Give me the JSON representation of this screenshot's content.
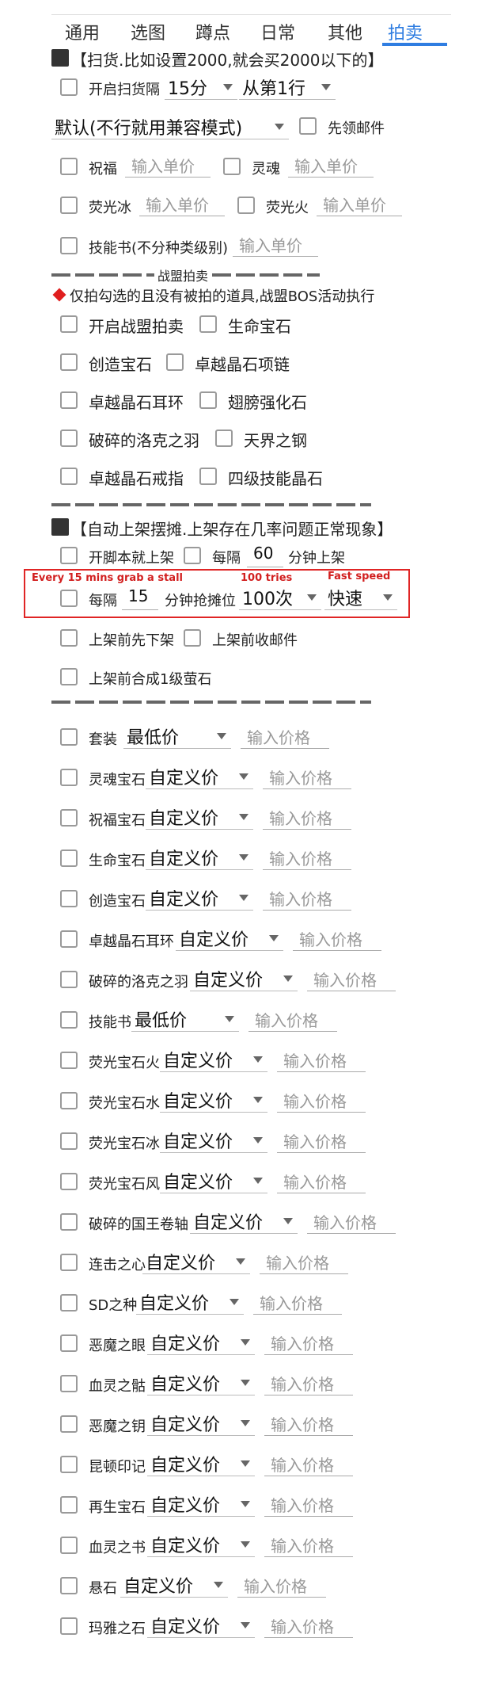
{
  "tabs": [
    "通用",
    "选图",
    "蹲点",
    "日常",
    "其他",
    "拍卖"
  ],
  "sweep": {
    "header": "【扫货.比如设置2000,就会买2000以下的】",
    "enable_label": "开启扫货隔",
    "interval_value": "15分",
    "row_value": "从第1行",
    "mode_value": "默认(不行就用兼容模式)",
    "mail_first_label": "先领邮件",
    "items": [
      {
        "label": "祝福",
        "placeholder": "输入单价"
      },
      {
        "label": "灵魂",
        "placeholder": "输入单价"
      },
      {
        "label": "荧光冰",
        "placeholder": "输入单价"
      },
      {
        "label": "荧光火",
        "placeholder": "输入单价"
      },
      {
        "label": "技能书(不分种类级别)",
        "placeholder": "输入单价"
      }
    ]
  },
  "alliance": {
    "divider_title": "战盟拍卖",
    "note": "仅拍勾选的且没有被拍的道具,战盟BOS活动执行",
    "items": [
      "开启战盟拍卖",
      "生命宝石",
      "创造宝石",
      "卓越晶石项链",
      "卓越晶石耳环",
      "翅膀强化石",
      "破碎的洛克之羽",
      "天界之钢",
      "卓越晶石戒指",
      "四级技能晶石"
    ]
  },
  "listing": {
    "header": "【自动上架摆摊.上架存在几率问题正常现象】",
    "open_label": "开脚本就上架",
    "every_label": "每隔",
    "every_value": "60",
    "every_unit": "分钟上架",
    "grab_every_label": "每隔",
    "grab_value": "15",
    "grab_unit": "分钟抢摊位",
    "tries_value": "100次",
    "speed_value": "快速",
    "annotations": {
      "grab": "Every 15 mins grab a stall",
      "tries": "100 tries",
      "speed": "Fast speed"
    },
    "before_unlist": "上架前先下架",
    "before_mail": "上架前收邮件",
    "before_merge": "上架前合成1级萤石"
  },
  "price_placeholder": "输入价格",
  "price_items": [
    {
      "label": "套装",
      "price_type": "最低价"
    },
    {
      "label": "灵魂宝石",
      "price_type": "自定义价"
    },
    {
      "label": "祝福宝石",
      "price_type": "自定义价"
    },
    {
      "label": "生命宝石",
      "price_type": "自定义价"
    },
    {
      "label": "创造宝石",
      "price_type": "自定义价"
    },
    {
      "label": "卓越晶石耳环",
      "price_type": "自定义价"
    },
    {
      "label": "破碎的洛克之羽",
      "price_type": "自定义价"
    },
    {
      "label": "技能书",
      "price_type": "最低价"
    },
    {
      "label": "荧光宝石火",
      "price_type": "自定义价"
    },
    {
      "label": "荧光宝石水",
      "price_type": "自定义价"
    },
    {
      "label": "荧光宝石冰",
      "price_type": "自定义价"
    },
    {
      "label": "荧光宝石风",
      "price_type": "自定义价"
    },
    {
      "label": "破碎的国王卷轴",
      "price_type": "自定义价"
    },
    {
      "label": "连击之心",
      "price_type": "自定义价"
    },
    {
      "label": "SD之种",
      "price_type": "自定义价"
    },
    {
      "label": "恶魔之眼",
      "price_type": "自定义价"
    },
    {
      "label": "血灵之骷",
      "price_type": "自定义价"
    },
    {
      "label": "恶魔之钥",
      "price_type": "自定义价"
    },
    {
      "label": "昆顿印记",
      "price_type": "自定义价"
    },
    {
      "label": "再生宝石",
      "price_type": "自定义价"
    },
    {
      "label": "血灵之书",
      "price_type": "自定义价"
    },
    {
      "label": "悬石",
      "price_type": "自定义价"
    },
    {
      "label": "玛雅之石",
      "price_type": "自定义价"
    }
  ],
  "colors": {
    "accent": "#2f7de1",
    "annotation": "#e02525"
  }
}
